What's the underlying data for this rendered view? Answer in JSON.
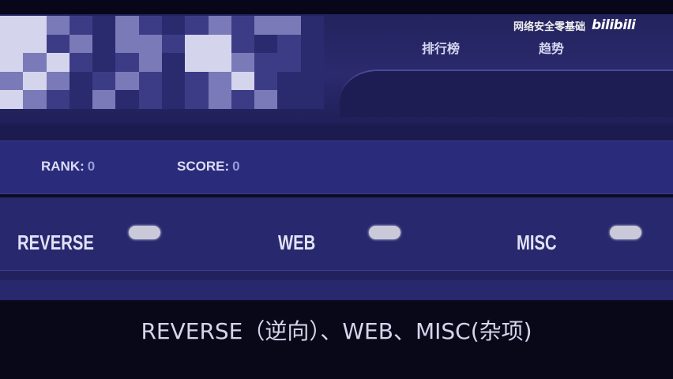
{
  "header": {
    "nav": {
      "rank_label": "排行榜",
      "trend_label": "趋势"
    },
    "watermark": {
      "channel_text": "网络安全零基础",
      "platform_logo_text": "bilibili"
    },
    "mosaic_colors": {
      "light": "#d4d4ec",
      "mid": "#7a7ab8",
      "dark": "#3c3c86",
      "bg": "#2a2a6e"
    }
  },
  "stats": {
    "rank_label": "RANK:",
    "rank_value": "0",
    "score_label": "SCORE:",
    "score_value": "0"
  },
  "categories": [
    {
      "label": "REVERSE"
    },
    {
      "label": "WEB"
    },
    {
      "label": "MISC"
    }
  ],
  "subtitle": "REVERSE（逆向）、WEB、MISC(杂项)",
  "colors": {
    "background": "#0c0b22",
    "band": "#2b2b7c",
    "text": "#dcdcf4",
    "toggle": "#c9c9d9"
  }
}
